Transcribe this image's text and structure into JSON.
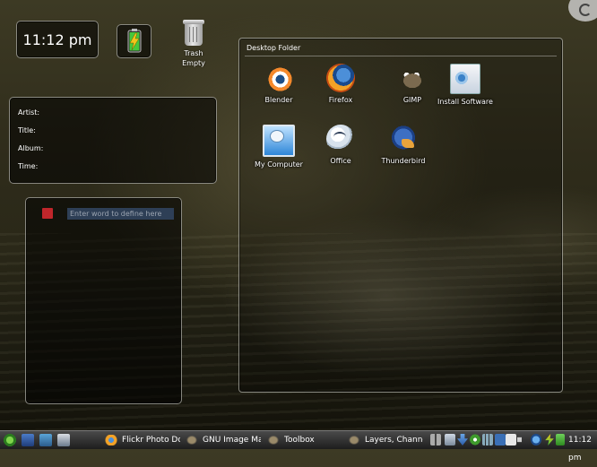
{
  "clock_widget": {
    "time": "11:12 pm"
  },
  "trash": {
    "label": "Trash",
    "status": "Empty"
  },
  "now_playing": {
    "artist_label": "Artist:",
    "title_label": "Title:",
    "album_label": "Album:",
    "time_label": "Time:"
  },
  "dictionary": {
    "placeholder": "Enter word to define here"
  },
  "desktop_folder": {
    "title": "Desktop Folder",
    "items": [
      {
        "label": "Blender",
        "icon": "blender-icon"
      },
      {
        "label": "Firefox",
        "icon": "firefox-icon"
      },
      {
        "label": "GIMP",
        "icon": "gimp-icon"
      },
      {
        "label": "Install Software",
        "icon": "install-software-icon"
      },
      {
        "label": "My Computer",
        "icon": "my-computer-icon"
      },
      {
        "label": "Office",
        "icon": "office-icon"
      },
      {
        "label": "Thunderbird",
        "icon": "thunderbird-icon"
      }
    ]
  },
  "taskbar": {
    "tasks": [
      {
        "label": "Flickr Photo Do",
        "icon": "firefox-icon"
      },
      {
        "label": "GNU Image Man",
        "icon": "gimp-icon"
      },
      {
        "label": "Toolbox",
        "icon": "gimp-icon"
      },
      {
        "label": "Layers, Channel",
        "icon": "gimp-icon"
      }
    ],
    "clock": "11:12 pm"
  },
  "colors": {
    "widget_border": "#c8c8be",
    "taskbar_bg": "#2a2a2a",
    "dict_input_bg": "#2e3f56",
    "battery_green": "#46c83c",
    "battery_bolt": "#f2c51a"
  }
}
